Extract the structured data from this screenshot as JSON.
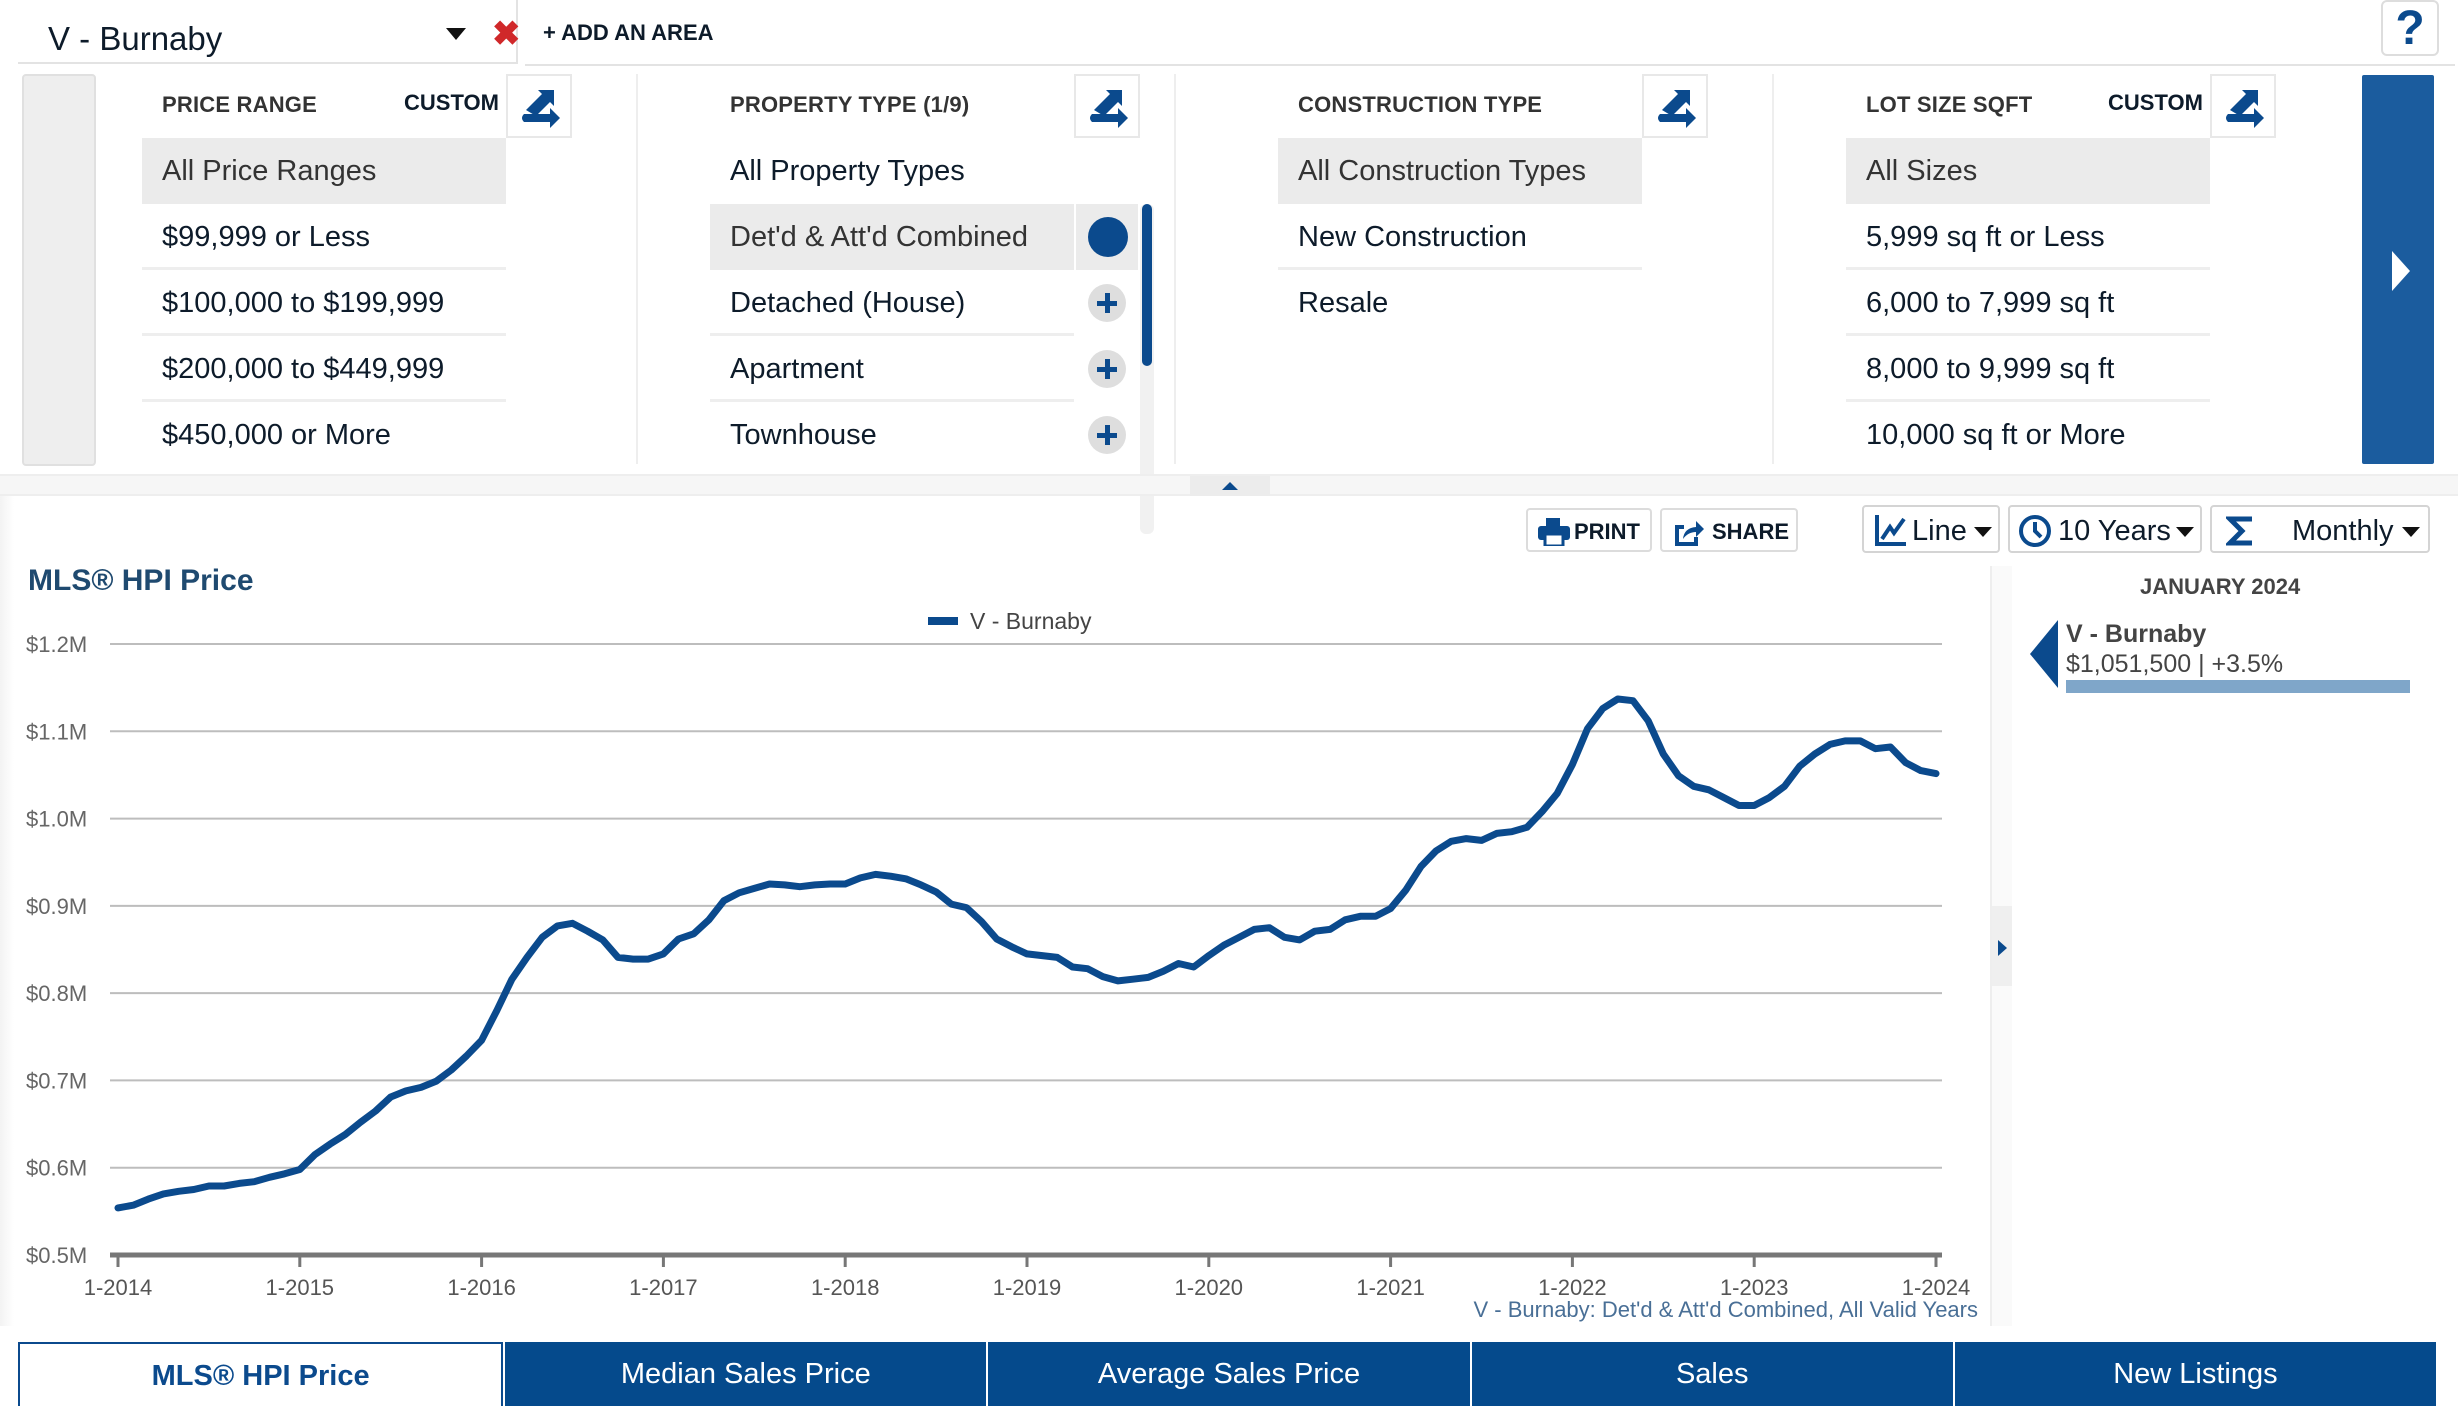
{
  "topbar": {
    "area_name": "V - Burnaby",
    "add_area_label": "+ ADD AN AREA",
    "help_label": "?"
  },
  "filters": {
    "price_range": {
      "title": "PRICE RANGE",
      "custom_label": "CUSTOM",
      "items": [
        "All Price Ranges",
        "$99,999 or Less",
        "$100,000 to $199,999",
        "$200,000 to $449,999",
        "$450,000 or More"
      ],
      "selected": 0
    },
    "property_type": {
      "title": "PROPERTY TYPE (1/9)",
      "items": [
        "All Property Types",
        "Det'd & Att'd Combined",
        "Detached (House)",
        "Apartment",
        "Townhouse"
      ],
      "selected": 1
    },
    "construction_type": {
      "title": "CONSTRUCTION TYPE",
      "items": [
        "All Construction Types",
        "New Construction",
        "Resale"
      ],
      "selected": 0
    },
    "lot_size": {
      "title": "LOT SIZE SQFT",
      "custom_label": "CUSTOM",
      "items": [
        "All Sizes",
        "5,999 sq ft or Less",
        "6,000 to 7,999 sq ft",
        "8,000 to 9,999 sq ft",
        "10,000 sq ft or More"
      ],
      "selected": 0
    }
  },
  "toolbar": {
    "print_label": "PRINT",
    "share_label": "SHARE",
    "chart_type": "Line",
    "period": "10 Years",
    "interval": "Monthly"
  },
  "info_panel": {
    "month": "JANUARY 2024",
    "area": "V - Burnaby",
    "value_text": "$1,051,500 | +3.5%"
  },
  "chart_data": {
    "type": "line",
    "title": "MLS® HPI Price",
    "legend": [
      "V - Burnaby"
    ],
    "legend_position": "top-center",
    "caption": "V - Burnaby: Det'd & Att'd Combined, All Valid Years",
    "xlabel": "",
    "ylabel": "",
    "x_start": "1-2014",
    "x_end": "1-2024",
    "x_interval": "monthly",
    "x_ticks": [
      "1-2014",
      "1-2015",
      "1-2016",
      "1-2017",
      "1-2018",
      "1-2019",
      "1-2020",
      "1-2021",
      "1-2022",
      "1-2023",
      "1-2024"
    ],
    "y_ticks": [
      "$0.5M",
      "$0.6M",
      "$0.7M",
      "$0.8M",
      "$0.9M",
      "$1.0M",
      "$1.1M",
      "$1.2M"
    ],
    "ylim": [
      0.5,
      1.2
    ],
    "yunit": "$M",
    "grid": true,
    "color": "#0b4a8d",
    "series": [
      {
        "name": "V - Burnaby",
        "values": [
          0.554,
          0.557,
          0.564,
          0.57,
          0.573,
          0.575,
          0.579,
          0.579,
          0.582,
          0.584,
          0.589,
          0.593,
          0.598,
          0.615,
          0.627,
          0.638,
          0.652,
          0.665,
          0.681,
          0.688,
          0.692,
          0.699,
          0.712,
          0.728,
          0.746,
          0.78,
          0.816,
          0.841,
          0.864,
          0.877,
          0.88,
          0.871,
          0.861,
          0.841,
          0.839,
          0.839,
          0.845,
          0.862,
          0.868,
          0.884,
          0.906,
          0.915,
          0.92,
          0.925,
          0.924,
          0.922,
          0.924,
          0.925,
          0.925,
          0.932,
          0.936,
          0.934,
          0.931,
          0.924,
          0.916,
          0.902,
          0.898,
          0.882,
          0.862,
          0.853,
          0.845,
          0.843,
          0.841,
          0.83,
          0.828,
          0.819,
          0.814,
          0.816,
          0.818,
          0.825,
          0.834,
          0.83,
          0.843,
          0.855,
          0.864,
          0.873,
          0.875,
          0.864,
          0.861,
          0.871,
          0.873,
          0.884,
          0.888,
          0.888,
          0.897,
          0.918,
          0.945,
          0.963,
          0.974,
          0.977,
          0.975,
          0.983,
          0.985,
          0.99,
          1.008,
          1.029,
          1.062,
          1.103,
          1.126,
          1.137,
          1.135,
          1.112,
          1.074,
          1.049,
          1.037,
          1.033,
          1.024,
          1.015,
          1.015,
          1.024,
          1.037,
          1.06,
          1.074,
          1.085,
          1.089,
          1.089,
          1.08,
          1.082,
          1.064,
          1.055,
          1.0515
        ]
      }
    ]
  },
  "tabs": [
    {
      "label": "MLS® HPI Price",
      "active": true
    },
    {
      "label": "Median Sales Price",
      "active": false
    },
    {
      "label": "Average Sales Price",
      "active": false
    },
    {
      "label": "Sales",
      "active": false
    },
    {
      "label": "New Listings",
      "active": false
    }
  ]
}
